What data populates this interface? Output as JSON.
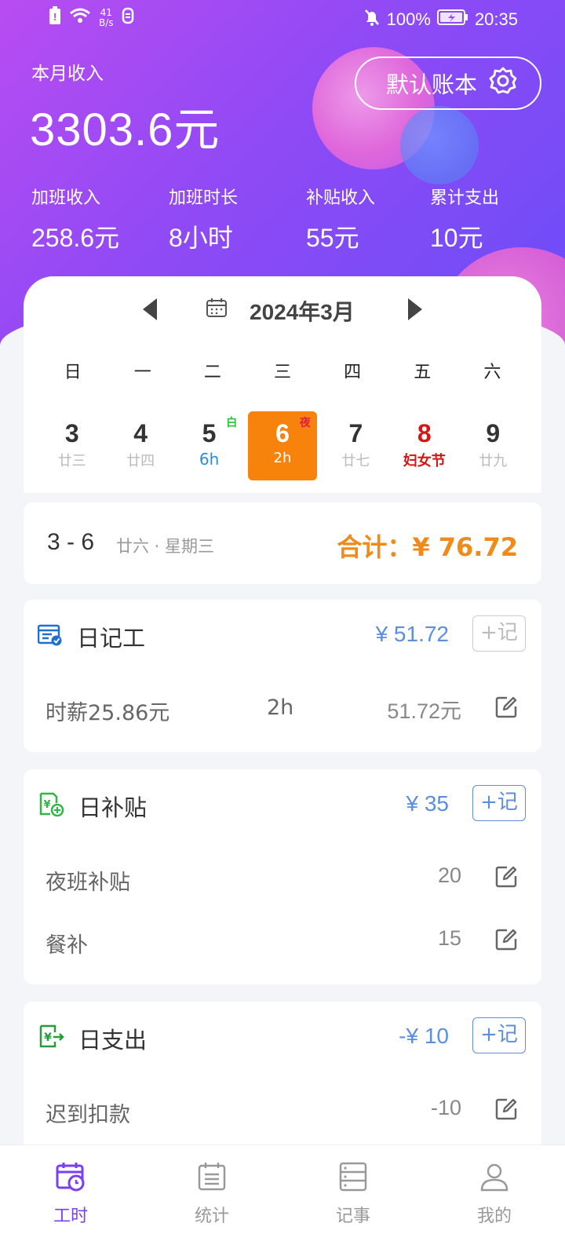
{
  "status_bar": {
    "net_speed_value": "41",
    "net_speed_unit": "B/s",
    "battery": "100%",
    "time": "20:35"
  },
  "header": {
    "month_income_label": "本月收入",
    "month_income_value": "3303.6元",
    "account_book_button": "默认账本",
    "stats": [
      {
        "label": "加班收入",
        "value": "258.6元"
      },
      {
        "label": "加班时长",
        "value": "8小时"
      },
      {
        "label": "补贴收入",
        "value": "55元"
      },
      {
        "label": "累计支出",
        "value": "10元"
      }
    ]
  },
  "calendar": {
    "title": "2024年3月",
    "weekdays": [
      "日",
      "一",
      "二",
      "三",
      "四",
      "五",
      "六"
    ],
    "days": [
      {
        "num": "3",
        "sub": "廿三"
      },
      {
        "num": "4",
        "sub": "廿四"
      },
      {
        "num": "5",
        "sub": "6h",
        "tag": "白"
      },
      {
        "num": "6",
        "sub": "2h",
        "tag": "夜"
      },
      {
        "num": "7",
        "sub": "廿七"
      },
      {
        "num": "8",
        "sub": "妇女节"
      },
      {
        "num": "9",
        "sub": "廿九"
      }
    ]
  },
  "summary": {
    "date": "3 - 6",
    "lunar": "廿六 · 星期三",
    "total": "合计：¥ 76.72"
  },
  "work_section": {
    "title": "日记工",
    "amount": "¥ 51.72",
    "add_label": "+记",
    "row": {
      "name": "时薪25.86元",
      "hours": "2h",
      "amount": "51.72元"
    }
  },
  "subsidy_section": {
    "title": "日补贴",
    "amount": "¥ 35",
    "add_label": "+记",
    "rows": [
      {
        "name": "夜班补贴",
        "amount": "20"
      },
      {
        "name": "餐补",
        "amount": "15"
      }
    ]
  },
  "expense_section": {
    "title": "日支出",
    "amount": "-¥ 10",
    "add_label": "+记",
    "rows": [
      {
        "name": "迟到扣款",
        "amount": "-10"
      }
    ]
  },
  "tabs": [
    {
      "label": "工时"
    },
    {
      "label": "统计"
    },
    {
      "label": "记事"
    },
    {
      "label": "我的"
    }
  ],
  "colors": {
    "accent": "#7a3ff2",
    "selected_day": "#f7830c",
    "total": "#f08a19",
    "amount_blue": "#5b8ee0"
  }
}
